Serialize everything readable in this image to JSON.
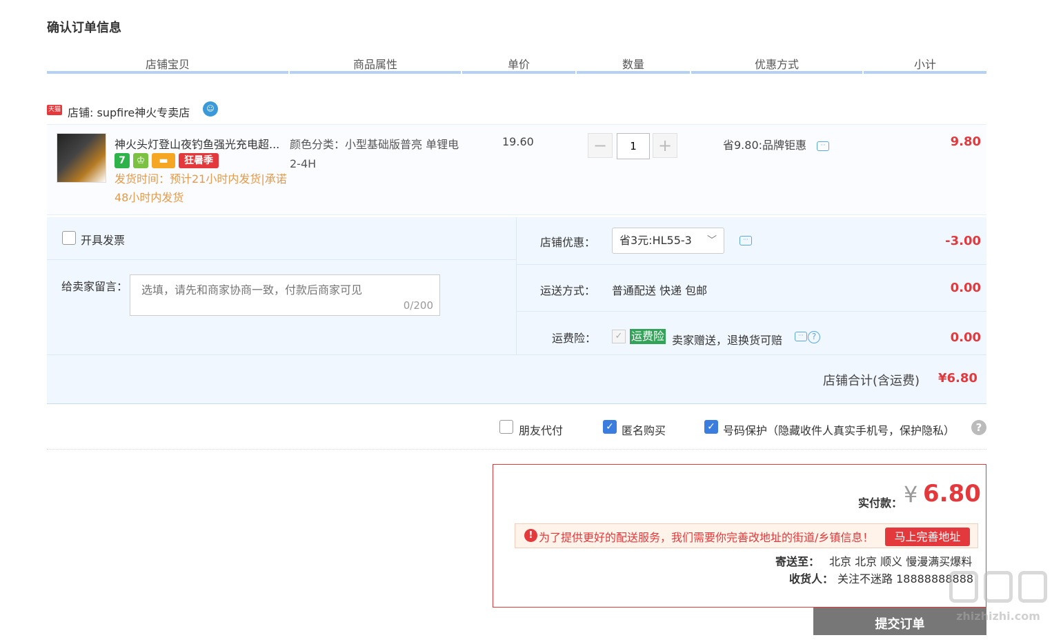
{
  "page": {
    "title": "确认订单信息"
  },
  "columns": [
    "店铺宝贝",
    "商品属性",
    "单价",
    "数量",
    "优惠方式",
    "小计"
  ],
  "shop": {
    "badge": "天猫",
    "name": "店铺: supfire神火专卖店"
  },
  "item": {
    "title": "神火头灯登山夜钓鱼强光充电超...",
    "tags": [
      "7",
      "",
      "",
      "狂暑季"
    ],
    "ship_note": "发货时间：预计21小时内发货|承诺48小时内发货",
    "attr": "颜色分类：小型基础版普亮 单锂电2-4H",
    "price": "19.60",
    "qty": "1",
    "qty_minus": "−",
    "qty_plus": "+",
    "discount": "省9.80:品牌钜惠",
    "subtotal": "9.80"
  },
  "invoice": {
    "label": "开具发票"
  },
  "message": {
    "label": "给卖家留言：",
    "placeholder": "选填，请先和商家协商一致，付款后商家可见",
    "counter": "0/200"
  },
  "store_coupon": {
    "label": "店铺优惠：",
    "value": "省3元:HL55-3",
    "amount": "-3.00"
  },
  "shipping": {
    "label": "运送方式：",
    "value": "普通配送 快递 包邮",
    "amount": "0.00"
  },
  "insurance": {
    "label": "运费险：",
    "badge": "运费险",
    "text": "卖家赠送，退换货可赔",
    "amount": "0.00"
  },
  "shop_total": {
    "label": "店铺合计(含运费)",
    "amount": "¥6.80"
  },
  "options": {
    "friend_pay": "朋友代付",
    "anonymous": "匿名购买",
    "number_protect": "号码保护（隐藏收件人真实手机号，保护隐私）",
    "help": "?"
  },
  "payment": {
    "label": "实付款：",
    "yen": "¥",
    "amount": "6.80",
    "warning": "为了提供更好的配送服务，我们需要你完善改地址的街道/乡镇信息！",
    "warning_icon": "!",
    "fix_btn": "马上完善地址",
    "ship_to_label": "寄送至：",
    "ship_to": "北京 北京 顺义 慢漫满买爆料",
    "receiver_label": "收货人：",
    "receiver": "关注不迷路 18888888888"
  },
  "submit": "提交订单",
  "watermark": "zhizhizhi.com"
}
